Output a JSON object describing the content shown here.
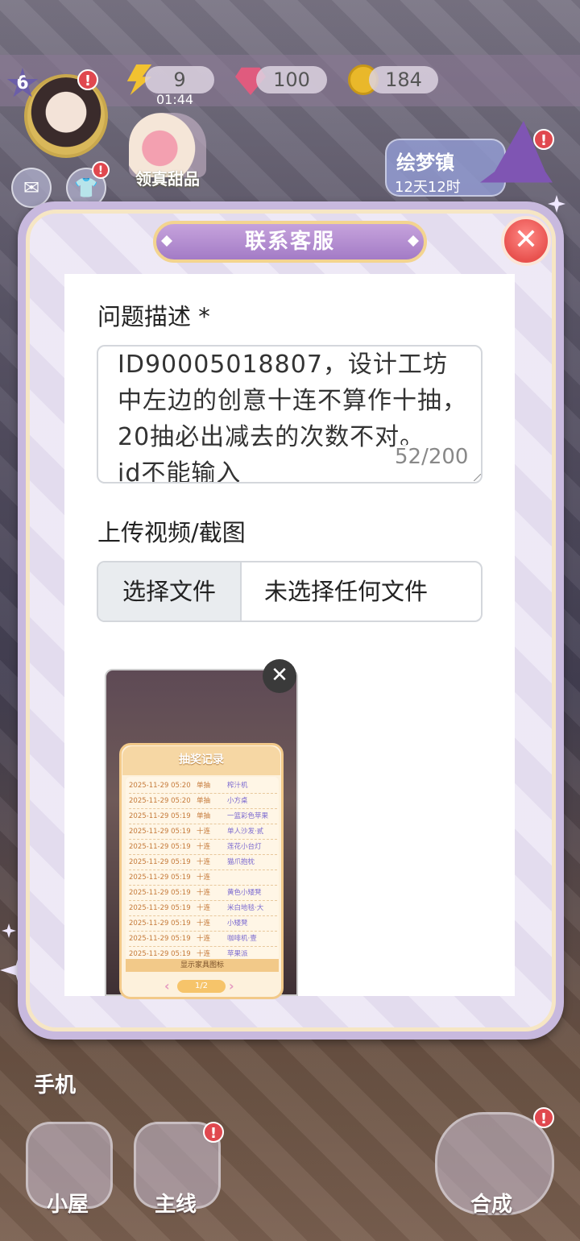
{
  "hud": {
    "level": "6",
    "alert": "!",
    "energy": "9",
    "energy_timer": "01:44",
    "gems": "100",
    "coins": "184",
    "dessert_label": "领真甜品",
    "dream_town": "绘梦镇",
    "dream_time": "12天12时"
  },
  "bottom_nav": {
    "phone": "手机",
    "house": "小屋",
    "main": "主线",
    "merge": "合成"
  },
  "modal": {
    "title": "联系客服",
    "close": "✕",
    "description_label": "问题描述 *",
    "description_value": "ID90005018807，设计工坊中左边的创意十连不算作十抽，20抽必出减去的次数不对。\nid不能输入",
    "char_count": "52/200",
    "upload_label": "上传视频/截图",
    "file_button": "选择文件",
    "file_status": "未选择任何文件",
    "remove_preview": "✕"
  },
  "preview": {
    "title": "抽奖记录",
    "rows": [
      {
        "date": "2025-11-29 05:20",
        "type": "单抽",
        "item": "榨汁机"
      },
      {
        "date": "2025-11-29 05:20",
        "type": "单抽",
        "item": "小方桌"
      },
      {
        "date": "2025-11-29 05:19",
        "type": "单抽",
        "item": "一篮彩色苹果"
      },
      {
        "date": "2025-11-29 05:19",
        "type": "十连",
        "item": "单人沙发·贰"
      },
      {
        "date": "2025-11-29 05:19",
        "type": "十连",
        "item": "莲花小台灯"
      },
      {
        "date": "2025-11-29 05:19",
        "type": "十连",
        "item": "猫爪抱枕"
      },
      {
        "date": "2025-11-29 05:19",
        "type": "十连",
        "item": ""
      },
      {
        "date": "2025-11-29 05:19",
        "type": "十连",
        "item": "黄色小矮凳"
      },
      {
        "date": "2025-11-29 05:19",
        "type": "十连",
        "item": "米白地毯·大"
      },
      {
        "date": "2025-11-29 05:19",
        "type": "十连",
        "item": "小矮凳"
      },
      {
        "date": "2025-11-29 05:19",
        "type": "十连",
        "item": "咖啡机·壹"
      },
      {
        "date": "2025-11-29 05:19",
        "type": "十连",
        "item": "苹果派"
      }
    ],
    "footer": "显示家具图标",
    "page": "1/2"
  }
}
